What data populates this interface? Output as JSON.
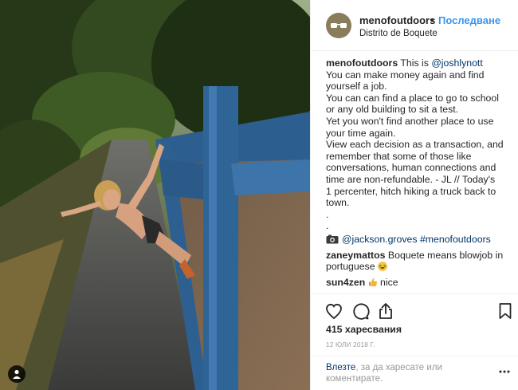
{
  "post": {
    "username": "menofoutdoors",
    "separator": "•",
    "follow_label": "Последване",
    "location": "Distrito de Boquete",
    "avatar_icon": "sunglasses-avatar-icon"
  },
  "caption": {
    "author": "menofoutdoors",
    "intro": "This is",
    "mention": "@joshlynott",
    "lines": [
      "You can make money again and find",
      "yourself a job.",
      "You can can find a place to go to school",
      "or any old building to sit a test.",
      "Yet you won't find another place to use",
      "your time again.",
      "View each decision as a transaction, and",
      "remember that some of those like",
      "conversations, human connections and",
      "time are non-refundable. - JL // Today's",
      "1 percenter, hitch hiking a truck back to",
      "town.",
      ".",
      "."
    ],
    "credit_mention": "@jackson.groves",
    "credit_hashtag": "#menofoutdoors"
  },
  "comments": [
    {
      "author": "zaneymattos",
      "text_line1": "Boquete means blowjob in",
      "text_line2": "portuguese",
      "emoji": "laughing-emoji"
    },
    {
      "author": "sun4zen",
      "text": "nice",
      "emoji": "thumbs-up-emoji"
    }
  ],
  "actions": {
    "like_icon": "heart-icon",
    "comment_icon": "comment-icon",
    "share_icon": "share-icon",
    "save_icon": "bookmark-icon"
  },
  "likes_text": "415 харесвания",
  "date_text": "12 ЮЛИ 2018 Г.",
  "login": {
    "link": "Влезте",
    "text": ", за да харесате или коментирате."
  },
  "colors": {
    "accent": "#3897f0",
    "link": "#003569",
    "muted": "#999999",
    "text": "#262626"
  }
}
